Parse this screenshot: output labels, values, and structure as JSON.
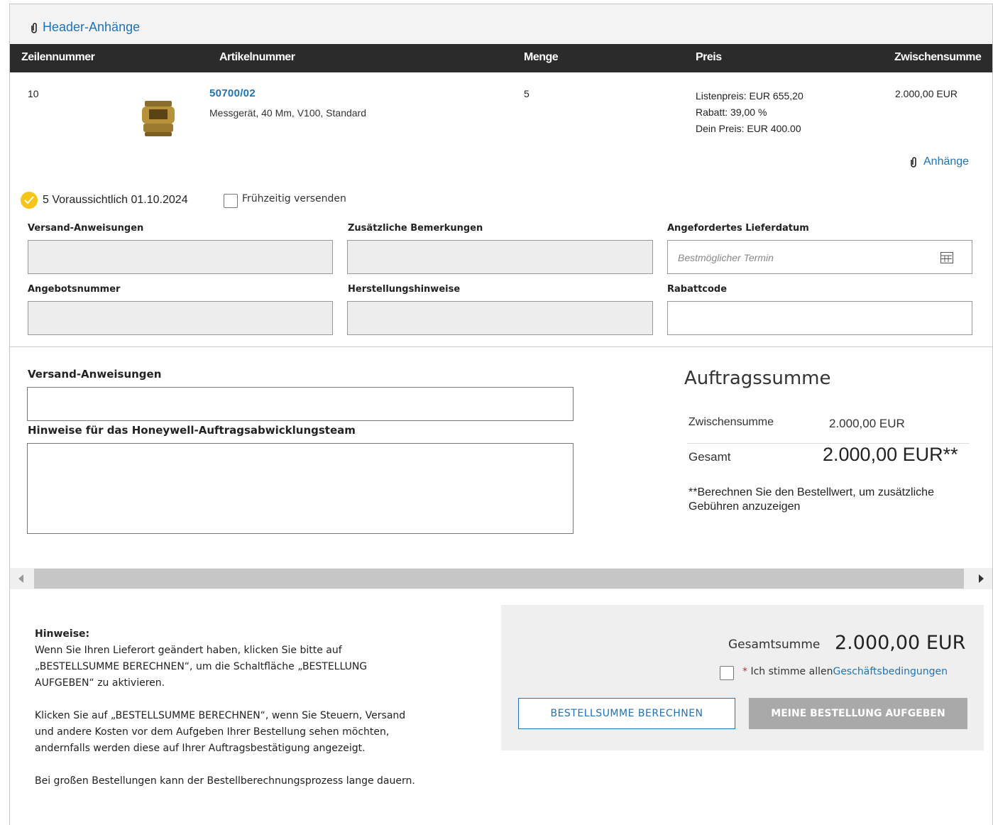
{
  "header_attachments": {
    "label": "Header-Anhänge",
    "icon": "paperclip-icon"
  },
  "table": {
    "columns": [
      "Zeilennummer",
      "Artikelnummer",
      "Menge",
      "Preis",
      "Zwischensumme"
    ],
    "row": {
      "line_number": "10",
      "part_number": "50700/02",
      "description": "Messgerät, 40 Mm, V100, Standard",
      "quantity": "5",
      "list_price": "Listenpreis: EUR 655,20",
      "discount": "Rabatt: 39,00 %",
      "your_price": "Dein Preis: EUR 400.00",
      "subtotal": "2.000,00 EUR",
      "attachments_label": "Anhänge",
      "availability": "5 Voraussichtlich 01.10.2024",
      "ship_early_label": "Frühzeitig versenden"
    }
  },
  "line_fields": {
    "shipping_instructions": "Versand-Anweisungen",
    "additional_remarks": "Zusätzliche Bemerkungen",
    "requested_delivery_date": "Angefordertes Lieferdatum",
    "delivery_placeholder": "Bestmöglicher Termin",
    "quote_number": "Angebotsnummer",
    "manufacturing_notes": "Herstellungshinweise",
    "discount_code": "Rabattcode"
  },
  "order_fields": {
    "shipping_instructions": "Versand-Anweisungen",
    "notes_team": "Hinweise für das Honeywell-Auftragsabwicklungsteam"
  },
  "order_summary": {
    "title": "Auftragssumme",
    "subtotal_label": "Zwischensumme",
    "subtotal_value": "2.000,00 EUR",
    "total_label": "Gesamt",
    "total_value": "2.000,00 EUR**",
    "note": "**Berechnen Sie den Bestellwert, um zusätzliche Gebühren anzuzeigen"
  },
  "hints": {
    "title": "Hinweise:",
    "p1": "Wenn Sie Ihren Lieferort geändert haben, klicken Sie bitte auf „BESTELLSUMME BERECHNEN“, um die Schaltfläche „BESTELLUNG AUFGEBEN“ zu aktivieren.",
    "p2": "Klicken Sie auf „BESTELLSUMME BERECHNEN“, wenn Sie Steuern, Versand und andere Kosten vor dem Aufgeben Ihrer Bestellung sehen möchten, andernfalls werden diese auf Ihrer Auftragsbestätigung angezeigt.",
    "p3": "Bei großen Bestellungen kann der Bestellberechnungsprozess lange dauern."
  },
  "checkout": {
    "grand_total_label": "Gesamtsumme",
    "grand_total_value": "2.000,00 EUR",
    "terms_star": "*",
    "terms_text": "Ich stimme allen",
    "terms_link": "Geschäftsbedingungen",
    "calculate_button": "BESTELLSUMME BERECHNEN",
    "place_order_button": "MEINE BESTELLUNG AUFGEBEN"
  },
  "colors": {
    "accent": "#1f73b7",
    "header_bg": "#2b2b2b",
    "check": "#f5c518",
    "disabled": "#a9a9a9"
  }
}
